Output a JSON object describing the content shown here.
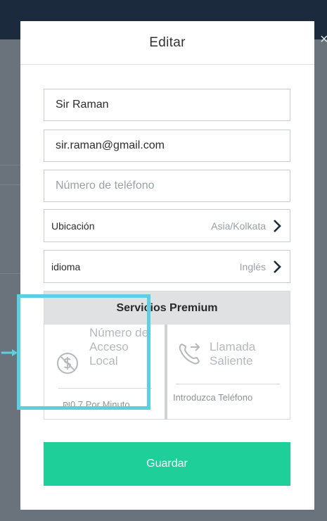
{
  "modal": {
    "title": "Editar",
    "fields": {
      "name_value": "Sir Raman",
      "email_value": "sir.raman@gmail.com",
      "phone_placeholder": "Número de teléfono"
    },
    "location": {
      "label": "Ubicación",
      "value": "Asia/Kolkata"
    },
    "language": {
      "label": "idioma",
      "value": "Inglés"
    },
    "premium": {
      "title": "Servicios Premium",
      "local_access": {
        "title": "Número de Acceso Local",
        "subtitle": "₪0.7 Por Minuto",
        "icon": "dollar-off-icon"
      },
      "outgoing_call": {
        "title": "Llamada Saliente",
        "subtitle": "Introduzca Teléfono",
        "icon": "phone-outgoing-icon"
      }
    },
    "save_label": "Guardar"
  },
  "background": {
    "close_glyph": "×"
  },
  "colors": {
    "accent": "#1ecf9a",
    "highlight": "#5ccfe0",
    "header_bar": "#1c2a3d",
    "overlay": "#6a737b"
  }
}
